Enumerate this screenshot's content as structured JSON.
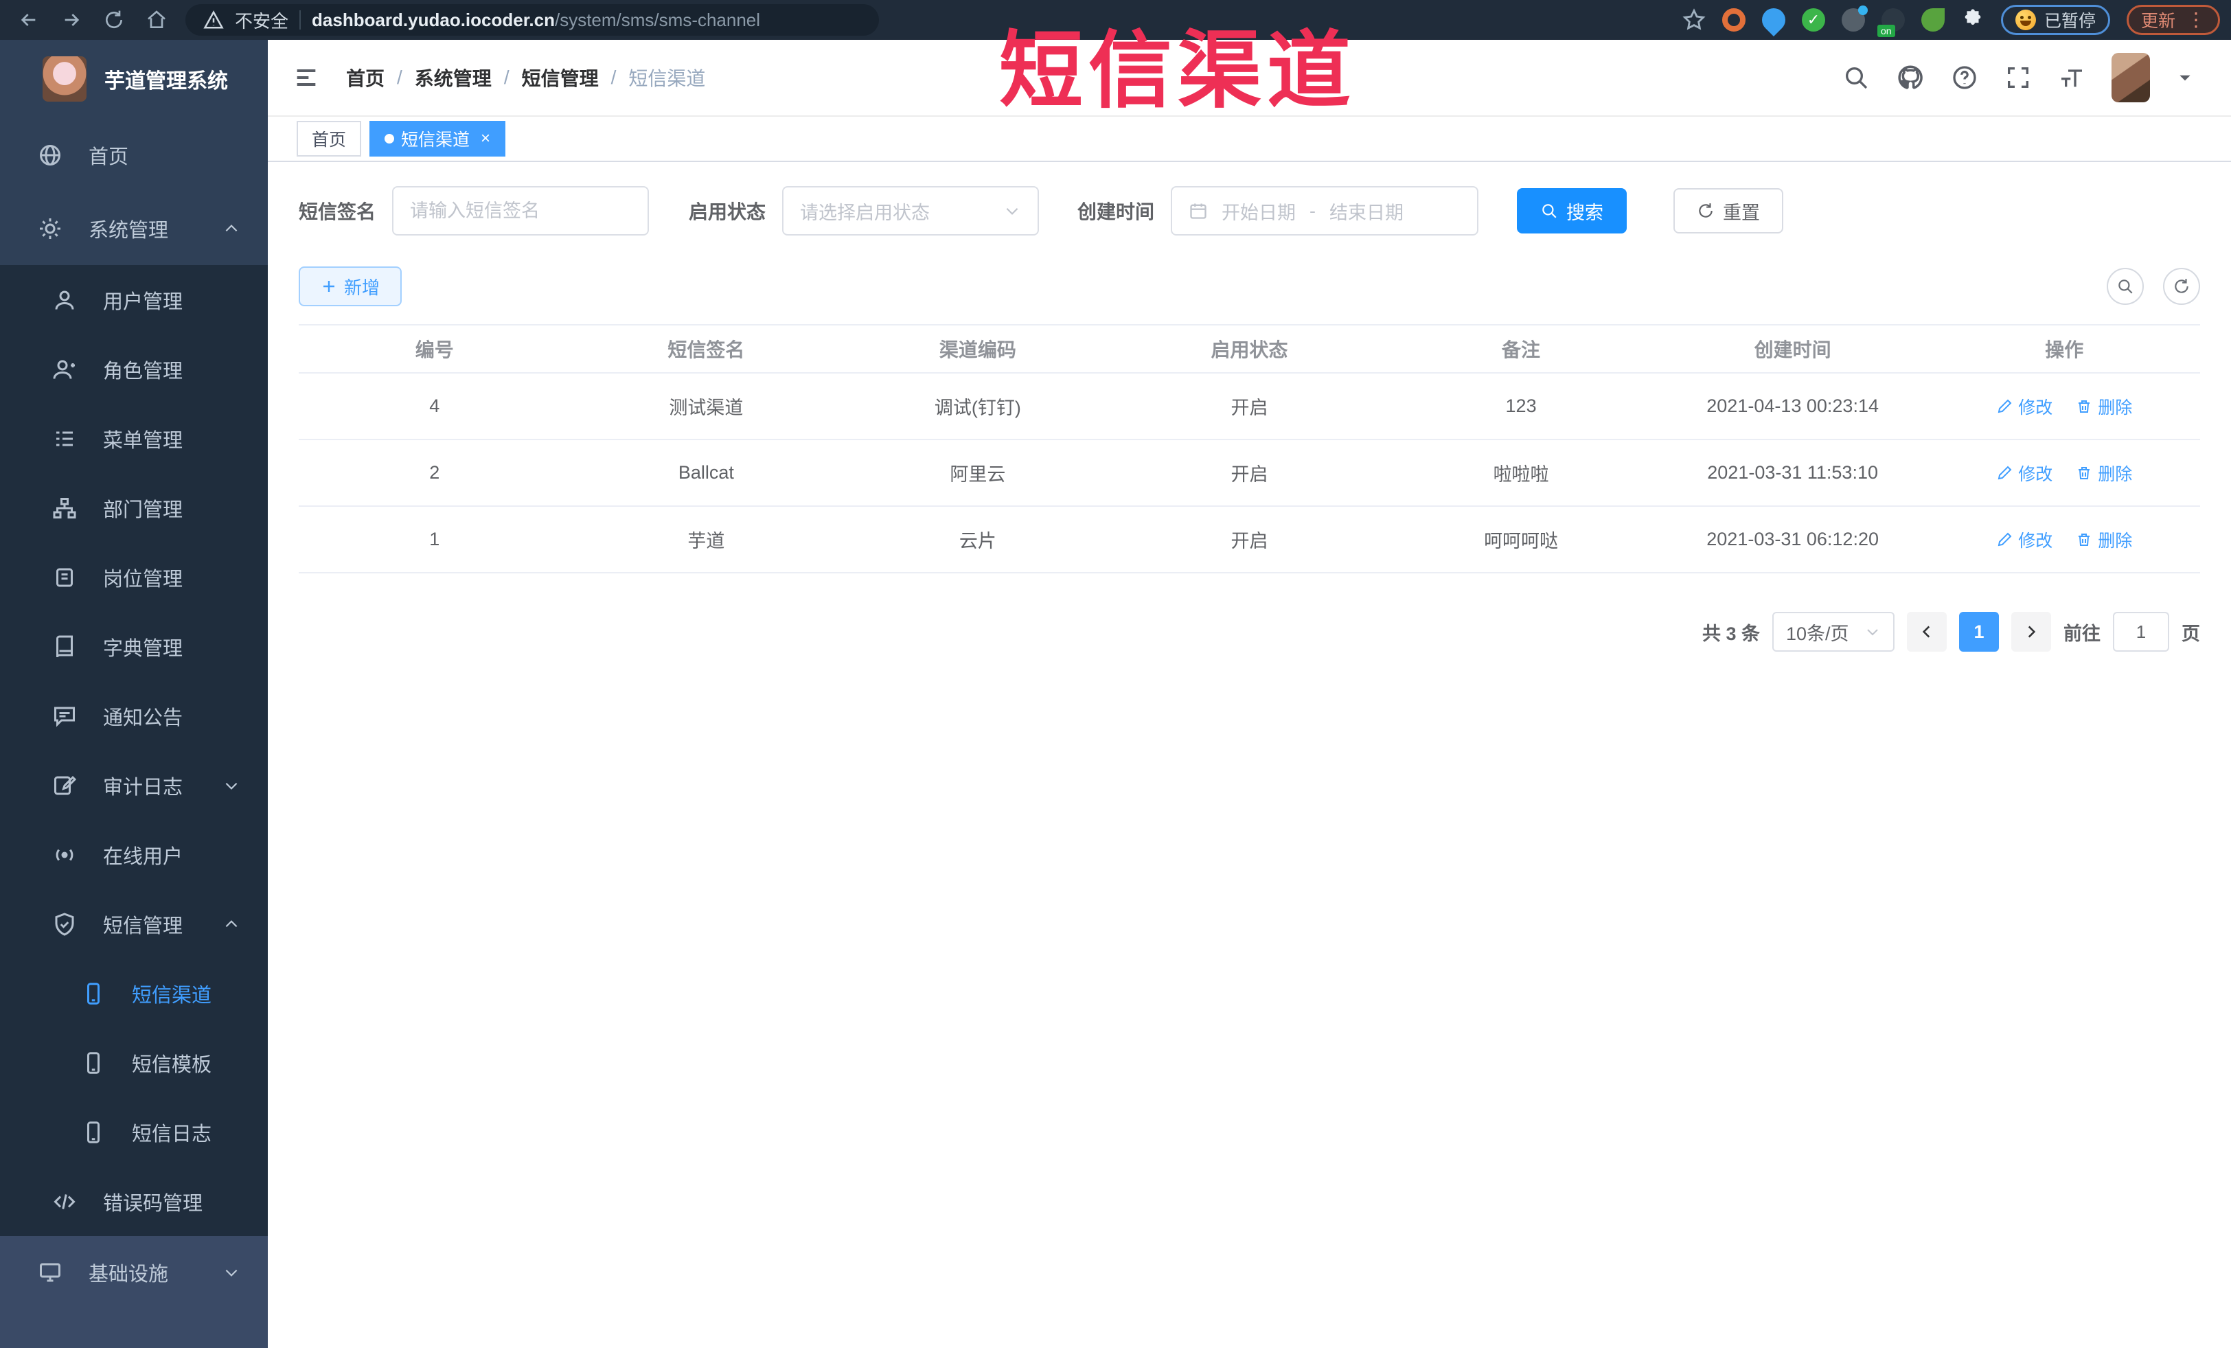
{
  "overlay_title": "短信渠道",
  "browser": {
    "security_label": "不安全",
    "url_host": "dashboard.yudao.iocoder.cn",
    "url_path": "/system/sms/sms-channel",
    "paused_label": "已暂停",
    "update_label": "更新"
  },
  "sidebar": {
    "app_title": "芋道管理系统",
    "items": [
      {
        "label": "首页",
        "icon": "dashboard-icon",
        "level": 1
      },
      {
        "label": "系统管理",
        "icon": "gear-icon",
        "level": 1,
        "arrow": "up"
      },
      {
        "label": "用户管理",
        "icon": "user-icon",
        "level": 2
      },
      {
        "label": "角色管理",
        "icon": "role-icon",
        "level": 2
      },
      {
        "label": "菜单管理",
        "icon": "menu-list-icon",
        "level": 2
      },
      {
        "label": "部门管理",
        "icon": "org-tree-icon",
        "level": 2
      },
      {
        "label": "岗位管理",
        "icon": "post-badge-icon",
        "level": 2
      },
      {
        "label": "字典管理",
        "icon": "dictionary-icon",
        "level": 2
      },
      {
        "label": "通知公告",
        "icon": "announcement-icon",
        "level": 2
      },
      {
        "label": "审计日志",
        "icon": "audit-log-icon",
        "level": 2,
        "arrow": "down"
      },
      {
        "label": "在线用户",
        "icon": "online-user-icon",
        "level": 2
      },
      {
        "label": "短信管理",
        "icon": "sms-shield-icon",
        "level": 2,
        "arrow": "up"
      },
      {
        "label": "短信渠道",
        "icon": "phone-icon",
        "level": 3,
        "active": true
      },
      {
        "label": "短信模板",
        "icon": "phone-icon",
        "level": 3
      },
      {
        "label": "短信日志",
        "icon": "phone-icon",
        "level": 3
      },
      {
        "label": "错误码管理",
        "icon": "code-icon",
        "level": 2
      },
      {
        "label": "基础设施",
        "icon": "infrastructure-icon",
        "level": 1,
        "arrow": "down"
      }
    ]
  },
  "header": {
    "breadcrumbs": [
      "首页",
      "系统管理",
      "短信管理",
      "短信渠道"
    ],
    "breadcrumb_separator": "/"
  },
  "tabs": {
    "items": [
      {
        "label": "首页",
        "active": false
      },
      {
        "label": "短信渠道",
        "active": true,
        "close": "×"
      }
    ]
  },
  "filters": {
    "sign_label": "短信签名",
    "sign_placeholder": "请输入短信签名",
    "status_label": "启用状态",
    "status_placeholder": "请选择启用状态",
    "time_label": "创建时间",
    "date_start_placeholder": "开始日期",
    "date_separator": "-",
    "date_end_placeholder": "结束日期",
    "search_label": "搜索",
    "reset_label": "重置"
  },
  "toolbar": {
    "add_label": "新增"
  },
  "table": {
    "headers": [
      "编号",
      "短信签名",
      "渠道编码",
      "启用状态",
      "备注",
      "创建时间",
      "操作"
    ],
    "rows": [
      {
        "id": "4",
        "sign": "测试渠道",
        "code": "调试(钉钉)",
        "status": "开启",
        "remark": "123",
        "created": "2021-04-13 00:23:14"
      },
      {
        "id": "2",
        "sign": "Ballcat",
        "code": "阿里云",
        "status": "开启",
        "remark": "啦啦啦",
        "created": "2021-03-31 11:53:10"
      },
      {
        "id": "1",
        "sign": "芋道",
        "code": "云片",
        "status": "开启",
        "remark": "呵呵呵哒",
        "created": "2021-03-31 06:12:20"
      }
    ],
    "edit_label": "修改",
    "delete_label": "删除"
  },
  "pagination": {
    "total_text": "共 3 条",
    "page_size": "10条/页",
    "current_page": "1",
    "goto_label": "前往",
    "goto_value": "1",
    "page_label": "页"
  },
  "colors": {
    "accent": "#409eff",
    "search_button": "#1890ff",
    "sidebar_bg": "#2f4057",
    "submenu_bg": "#1f2d3d",
    "overlay_red": "#ee2f55"
  }
}
